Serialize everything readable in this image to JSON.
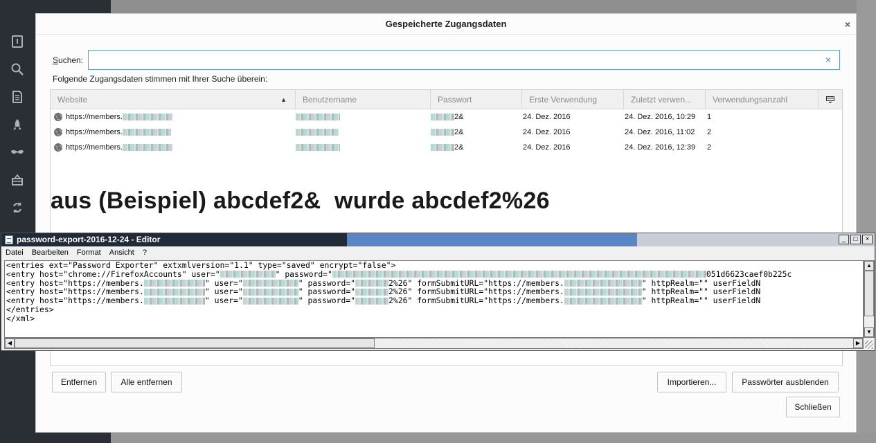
{
  "dialog": {
    "title": "Gespeicherte Zugangsdaten",
    "close": "×"
  },
  "search": {
    "label_accesskey": "S",
    "label_rest": "uchen:",
    "value": "",
    "clear": "×"
  },
  "match_text": "Folgende Zugangsdaten stimmen mit Ihrer Suche überein:",
  "table": {
    "columns": [
      "Website",
      "Benutzername",
      "Passwort",
      "Erste Verwendung",
      "Zuletzt verwen...",
      "Verwendungsanzahl"
    ],
    "sort_indicator": "▲",
    "column_picker_icon": "column-picker-icon",
    "rows": [
      {
        "website": "https://members.",
        "password_tail": "2&",
        "first_used": "24. Dez. 2016",
        "last_used": "24. Dez. 2016, 10:29",
        "count": "1"
      },
      {
        "website": "https://members.",
        "password_tail": "2&",
        "first_used": "24. Dez. 2016",
        "last_used": "24. Dez. 2016, 11:02",
        "count": "2"
      },
      {
        "website": "https://members.",
        "password_tail": "2&",
        "first_used": "24. Dez. 2016",
        "last_used": "24. Dez. 2016, 12:39",
        "count": "2"
      }
    ]
  },
  "annotation": "aus (Beispiel) abcdef2&  wurde abcdef2%26",
  "editor": {
    "title": "password-export-2016-12-24 - Editor",
    "menu": [
      "Datei",
      "Bearbeiten",
      "Format",
      "Ansicht",
      "?"
    ],
    "window_buttons": [
      "_",
      "□",
      "×"
    ],
    "lines": [
      {
        "a": "<entries ext=\"Password Exporter\" extxmlversion=\"1.1\" type=\"saved\" encrypt=\"false\">"
      },
      {
        "a": "<entry host=\"chrome://FirefoxAccounts\" user=\"",
        "b": "\" password=\"",
        "c": "051d6623caef0b225c"
      },
      {
        "a": "<entry host=\"https://members.",
        "b": "\" user=\"",
        "c": "\" password=\"",
        "d": "2%26\" formSubmitURL=\"https://members.",
        "e": "\" httpRealm=\"\" userFieldN"
      },
      {
        "a": "<entry host=\"https://members.",
        "b": "\" user=\"",
        "c": "\" password=\"",
        "d": "2%26\" formSubmitURL=\"https://members.",
        "e": "\" httpRealm=\"\" userFieldN"
      },
      {
        "a": "<entry host=\"https://members.",
        "b": "\" user=\"",
        "c": "\" password=\"",
        "d": "2%26\" formSubmitURL=\"https://members.",
        "e": "\" httpRealm=\"\" userFieldN"
      },
      {
        "a": "</entries>"
      },
      {
        "a": "</xml>"
      }
    ]
  },
  "buttons": {
    "remove": "Entfernen",
    "remove_all": "Alle entfernen",
    "import": "Importieren...",
    "hide_passwords": "Passwörter ausblenden",
    "close": "Schließen"
  }
}
